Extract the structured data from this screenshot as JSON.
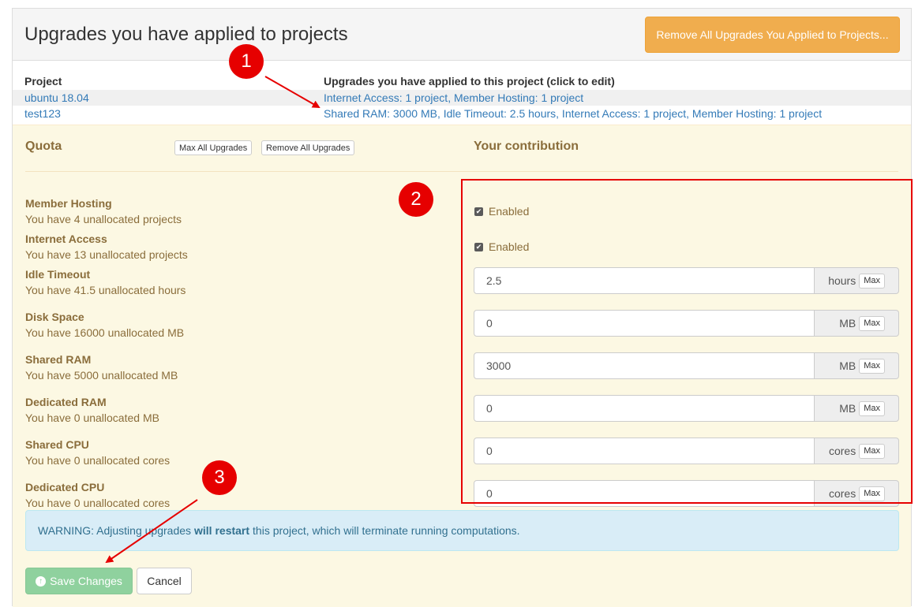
{
  "header": {
    "title": "Upgrades you have applied to projects",
    "remove_all_label": "Remove All Upgrades You Applied to Projects..."
  },
  "applied": {
    "col_project": "Project",
    "col_upgrades": "Upgrades you have applied to this project (click to edit)",
    "rows": [
      {
        "project": "ubuntu 18.04",
        "upgrades": "Internet Access: 1 project, Member Hosting: 1 project"
      },
      {
        "project": "test123",
        "upgrades": "Shared RAM: 3000 MB, Idle Timeout: 2.5 hours, Internet Access: 1 project, Member Hosting: 1 project"
      }
    ]
  },
  "quota": {
    "title": "Quota",
    "max_all_label": "Max All Upgrades",
    "remove_all_label": "Remove All Upgrades",
    "contribution_title": "Your contribution",
    "items": [
      {
        "name": "Member Hosting",
        "desc": "You have 4 unallocated projects",
        "kind": "checkbox",
        "label": "Enabled"
      },
      {
        "name": "Internet Access",
        "desc": "You have 13 unallocated projects",
        "kind": "checkbox",
        "label": "Enabled"
      },
      {
        "name": "Idle Timeout",
        "desc": "You have 41.5 unallocated hours",
        "kind": "input",
        "value": "2.5",
        "unit": "hours"
      },
      {
        "name": "Disk Space",
        "desc": "You have 16000 unallocated MB",
        "kind": "input",
        "value": "0",
        "unit": "MB"
      },
      {
        "name": "Shared RAM",
        "desc": "You have 5000 unallocated MB",
        "kind": "input",
        "value": "3000",
        "unit": "MB"
      },
      {
        "name": "Dedicated RAM",
        "desc": "You have 0 unallocated MB",
        "kind": "input",
        "value": "0",
        "unit": "MB"
      },
      {
        "name": "Shared CPU",
        "desc": "You have 0 unallocated cores",
        "kind": "input",
        "value": "0",
        "unit": "cores"
      },
      {
        "name": "Dedicated CPU",
        "desc": "You have 0 unallocated cores",
        "kind": "input",
        "value": "0",
        "unit": "cores"
      }
    ],
    "max_label": "Max"
  },
  "warning": {
    "prefix": "WARNING: Adjusting upgrades",
    "bold": "will restart",
    "suffix": "this project, which will terminate running computations."
  },
  "actions": {
    "save_label": "Save Changes",
    "cancel_label": "Cancel"
  },
  "annotations": {
    "badges": [
      "1",
      "2",
      "3"
    ],
    "color": "#e60000"
  },
  "icons": {
    "save": "arrow-circle-up-icon",
    "checkbox": "checkbox-checked-icon"
  }
}
